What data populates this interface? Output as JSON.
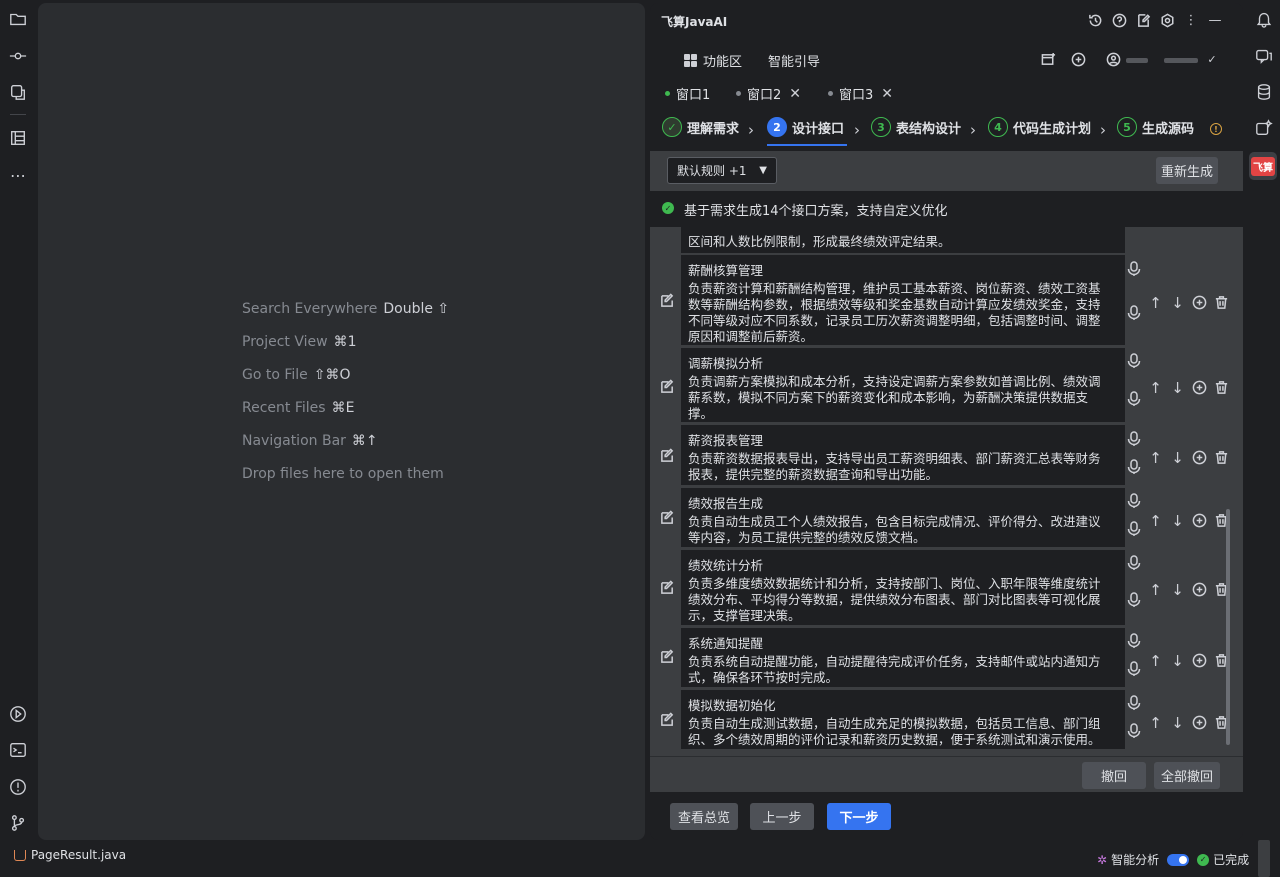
{
  "editor_hints": [
    {
      "label": "Search Everywhere",
      "shortcut": "Double ⇧"
    },
    {
      "label": "Project View",
      "shortcut": "⌘1"
    },
    {
      "label": "Go to File",
      "shortcut": "⇧⌘O"
    },
    {
      "label": "Recent Files",
      "shortcut": "⌘E"
    },
    {
      "label": "Navigation Bar",
      "shortcut": "⌘↑"
    },
    {
      "label": "Drop files here to open them",
      "shortcut": ""
    }
  ],
  "panel": {
    "title": "飞算JavaAI",
    "nav": {
      "features": "功能区",
      "guide": "智能引导"
    },
    "tabs": [
      {
        "label": "窗口1",
        "active": true
      },
      {
        "label": "窗口2",
        "closable": true
      },
      {
        "label": "窗口3",
        "closable": true
      }
    ],
    "steps": [
      {
        "num": "✓",
        "label": "理解需求"
      },
      {
        "num": "2",
        "label": "设计接口"
      },
      {
        "num": "3",
        "label": "表结构设计"
      },
      {
        "num": "4",
        "label": "代码生成计划"
      },
      {
        "num": "5",
        "label": "生成源码"
      }
    ],
    "rules_dropdown": "默认规则 +1",
    "regenerate": "重新生成",
    "status_message": "基于需求生成14个接口方案，支持自定义优化",
    "partial_top_text": "区间和人数比例限制，形成最终绩效评定结果。",
    "interfaces": [
      {
        "title": "薪酬核算管理",
        "desc": "负责薪资计算和薪酬结构管理，维护员工基本薪资、岗位薪资、绩效工资基\n数等薪酬结构参数，根据绩效等级和奖金基数自动计算应发绩效奖金，支持\n不同等级对应不同系数，记录员工历次薪资调整明细，包括调整时间、调整\n原因和调整前后薪资。"
      },
      {
        "title": "调薪模拟分析",
        "desc": "负责调薪方案模拟和成本分析，支持设定调薪方案参数如普调比例、绩效调\n薪系数，模拟不同方案下的薪资变化和成本影响，为薪酬决策提供数据支\n撑。"
      },
      {
        "title": "薪资报表管理",
        "desc": "负责薪资数据报表导出，支持导出员工薪资明细表、部门薪资汇总表等财务\n报表，提供完整的薪资数据查询和导出功能。"
      },
      {
        "title": "绩效报告生成",
        "desc": "负责自动生成员工个人绩效报告，包含目标完成情况、评价得分、改进建议\n等内容，为员工提供完整的绩效反馈文档。"
      },
      {
        "title": "绩效统计分析",
        "desc": "负责多维度绩效数据统计和分析，支持按部门、岗位、入职年限等维度统计\n绩效分布、平均得分等数据，提供绩效分布图表、部门对比图表等可视化展\n示，支撑管理决策。"
      },
      {
        "title": "系统通知提醒",
        "desc": "负责系统自动提醒功能，自动提醒待完成评价任务，支持邮件或站内通知方\n式，确保各环节按时完成。"
      },
      {
        "title": "模拟数据初始化",
        "desc": "负责自动生成测试数据，自动生成充足的模拟数据，包括员工信息、部门组\n织、多个绩效周期的评价记录和薪资历史数据，便于系统测试和演示使用。"
      }
    ],
    "undo": "撤回",
    "undo_all": "全部撤回",
    "view_overview": "查看总览",
    "prev_step": "上一步",
    "next_step": "下一步"
  },
  "statusbar": {
    "file": "PageResult.java",
    "smart_analysis": "智能分析",
    "done": "已完成"
  },
  "colors": {
    "accent": "#3574f0",
    "success": "#3fb950",
    "danger": "#e24444"
  }
}
